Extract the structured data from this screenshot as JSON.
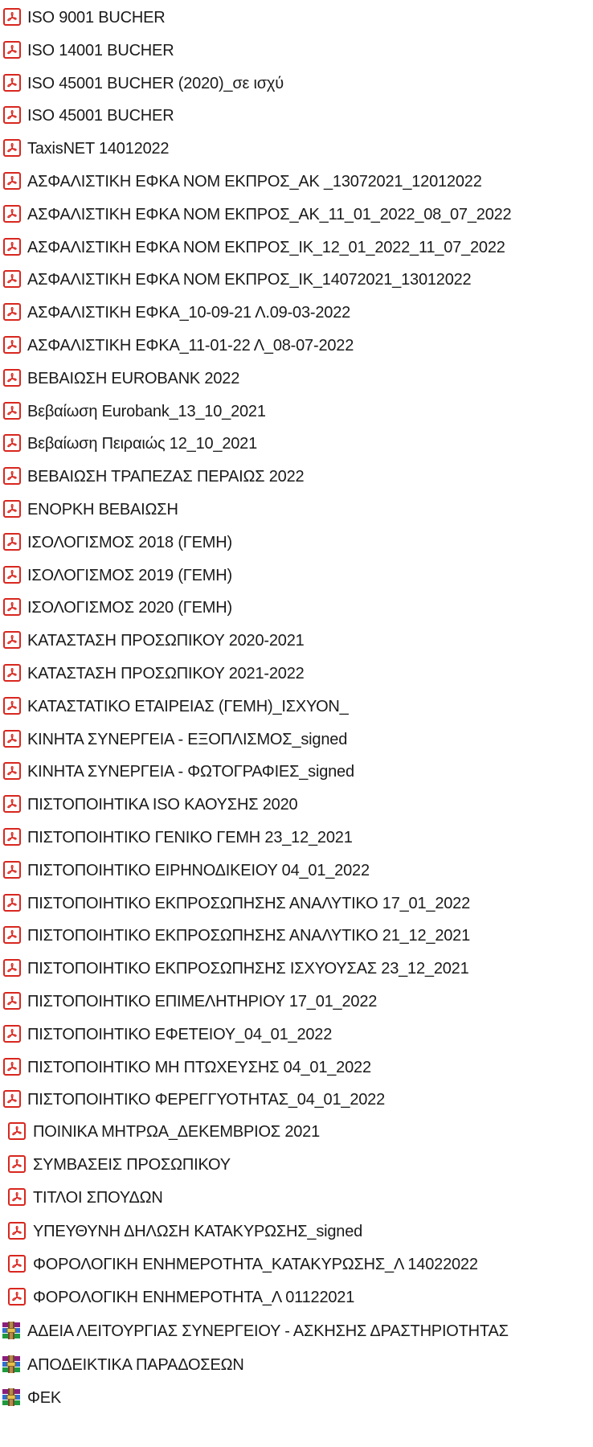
{
  "files": [
    {
      "name": "ISO 9001 BUCHER",
      "type": "pdf",
      "icon": "pdf-file-icon"
    },
    {
      "name": "ISO 14001 BUCHER",
      "type": "pdf",
      "icon": "pdf-file-icon"
    },
    {
      "name": "ISO 45001 BUCHER (2020)_σε ισχύ",
      "type": "pdf",
      "icon": "pdf-file-icon"
    },
    {
      "name": "ISO 45001 BUCHER",
      "type": "pdf",
      "icon": "pdf-file-icon"
    },
    {
      "name": "TaxisNET 14012022",
      "type": "pdf",
      "icon": "pdf-file-icon"
    },
    {
      "name": "ΑΣΦΑΛΙΣΤΙΚΗ ΕΦΚΑ ΝΟΜ ΕΚΠΡΟΣ_ΑΚ _13072021_12012022",
      "type": "pdf",
      "icon": "pdf-file-icon"
    },
    {
      "name": "ΑΣΦΑΛΙΣΤΙΚΗ ΕΦΚΑ ΝΟΜ ΕΚΠΡΟΣ_ΑΚ_11_01_2022_08_07_2022",
      "type": "pdf",
      "icon": "pdf-file-icon"
    },
    {
      "name": "ΑΣΦΑΛΙΣΤΙΚΗ ΕΦΚΑ ΝΟΜ ΕΚΠΡΟΣ_ΙΚ_12_01_2022_11_07_2022",
      "type": "pdf",
      "icon": "pdf-file-icon"
    },
    {
      "name": "ΑΣΦΑΛΙΣΤΙΚΗ ΕΦΚΑ ΝΟΜ ΕΚΠΡΟΣ_ΙΚ_14072021_13012022",
      "type": "pdf",
      "icon": "pdf-file-icon"
    },
    {
      "name": "ΑΣΦΑΛΙΣΤΙΚΗ ΕΦΚΑ_10-09-21 Λ.09-03-2022",
      "type": "pdf",
      "icon": "pdf-file-icon"
    },
    {
      "name": "ΑΣΦΑΛΙΣΤΙΚΗ ΕΦΚΑ_11-01-22 Λ_08-07-2022",
      "type": "pdf",
      "icon": "pdf-file-icon"
    },
    {
      "name": "ΒΕΒΑΙΩΣΗ EUROBANK 2022",
      "type": "pdf",
      "icon": "pdf-file-icon"
    },
    {
      "name": "Βεβαίωση Eurobank_13_10_2021",
      "type": "pdf",
      "icon": "pdf-file-icon"
    },
    {
      "name": "Βεβαίωση Πειραιώς 12_10_2021",
      "type": "pdf",
      "icon": "pdf-file-icon"
    },
    {
      "name": "ΒΕΒΑΙΩΣΗ ΤΡΑΠΕΖΑΣ ΠΕΡΑΙΩΣ 2022",
      "type": "pdf",
      "icon": "pdf-file-icon"
    },
    {
      "name": "ΕΝΟΡΚΗ ΒΕΒΑΙΩΣΗ",
      "type": "pdf",
      "icon": "pdf-file-icon"
    },
    {
      "name": "ΙΣΟΛΟΓΙΣΜΟΣ 2018 (ΓΕΜΗ)",
      "type": "pdf",
      "icon": "pdf-file-icon"
    },
    {
      "name": "ΙΣΟΛΟΓΙΣΜΟΣ 2019 (ΓΕΜΗ)",
      "type": "pdf",
      "icon": "pdf-file-icon"
    },
    {
      "name": "ΙΣΟΛΟΓΙΣΜΟΣ 2020 (ΓΕΜΗ)",
      "type": "pdf",
      "icon": "pdf-file-icon"
    },
    {
      "name": "ΚΑΤΑΣΤΑΣΗ ΠΡΟΣΩΠΙΚΟΥ 2020-2021",
      "type": "pdf",
      "icon": "pdf-file-icon"
    },
    {
      "name": "ΚΑΤΑΣΤΑΣΗ ΠΡΟΣΩΠΙΚΟΥ 2021-2022",
      "type": "pdf",
      "icon": "pdf-file-icon"
    },
    {
      "name": "ΚΑΤΑΣΤΑΤΙΚΟ ΕΤΑΙΡΕΙΑΣ (ΓΕΜΗ)_ΙΣΧΥΟΝ_",
      "type": "pdf",
      "icon": "pdf-file-icon"
    },
    {
      "name": "ΚΙΝΗΤΑ ΣΥΝΕΡΓΕΙΑ - ΕΞΟΠΛΙΣΜΟΣ_signed",
      "type": "pdf",
      "icon": "pdf-file-icon"
    },
    {
      "name": "ΚΙΝΗΤΑ ΣΥΝΕΡΓΕΙΑ - ΦΩΤΟΓΡΑΦΙΕΣ_signed",
      "type": "pdf",
      "icon": "pdf-file-icon"
    },
    {
      "name": "ΠΙΣΤΟΠΟΙΗΤΙΚΑ ISO ΚΑΟΥΣΗΣ 2020",
      "type": "pdf",
      "icon": "pdf-file-icon"
    },
    {
      "name": "ΠΙΣΤΟΠΟΙΗΤΙΚΟ ΓΕΝΙΚΟ ΓΕΜΗ 23_12_2021",
      "type": "pdf",
      "icon": "pdf-file-icon"
    },
    {
      "name": "ΠΙΣΤΟΠΟΙΗΤΙΚΟ ΕΙΡΗΝΟΔΙΚΕΙΟΥ 04_01_2022",
      "type": "pdf",
      "icon": "pdf-file-icon"
    },
    {
      "name": "ΠΙΣΤΟΠΟΙΗΤΙΚΟ ΕΚΠΡΟΣΩΠΗΣΗΣ ΑΝΑΛΥΤΙΚΟ 17_01_2022",
      "type": "pdf",
      "icon": "pdf-file-icon"
    },
    {
      "name": "ΠΙΣΤΟΠΟΙΗΤΙΚΟ ΕΚΠΡΟΣΩΠΗΣΗΣ ΑΝΑΛΥΤΙΚΟ 21_12_2021",
      "type": "pdf",
      "icon": "pdf-file-icon"
    },
    {
      "name": "ΠΙΣΤΟΠΟΙΗΤΙΚΟ ΕΚΠΡΟΣΩΠΗΣΗΣ ΙΣΧΥΟΥΣΑΣ 23_12_2021",
      "type": "pdf",
      "icon": "pdf-file-icon"
    },
    {
      "name": "ΠΙΣΤΟΠΟΙΗΤΙΚΟ ΕΠΙΜΕΛΗΤΗΡΙΟΥ 17_01_2022",
      "type": "pdf",
      "icon": "pdf-file-icon"
    },
    {
      "name": "ΠΙΣΤΟΠΟΙΗΤΙΚΟ ΕΦΕΤΕΙΟΥ_04_01_2022",
      "type": "pdf",
      "icon": "pdf-file-icon"
    },
    {
      "name": "ΠΙΣΤΟΠΟΙΗΤΙΚΟ ΜΗ ΠΤΩΧΕΥΣΗΣ 04_01_2022",
      "type": "pdf",
      "icon": "pdf-file-icon"
    },
    {
      "name": "ΠΙΣΤΟΠΟΙΗΤΙΚΟ ΦΕΡΕΓΓΥΟΤΗΤΑΣ_04_01_2022",
      "type": "pdf",
      "icon": "pdf-file-icon"
    },
    {
      "name": "ΠΟΙΝΙΚΑ ΜΗΤΡΩΑ_ΔΕΚΕΜΒΡΙΟΣ 2021",
      "type": "pdf",
      "icon": "pdf-file-icon"
    },
    {
      "name": "ΣΥΜΒΑΣΕΙΣ ΠΡΟΣΩΠΙΚΟΥ",
      "type": "pdf",
      "icon": "pdf-file-icon"
    },
    {
      "name": "ΤΙΤΛΟΙ ΣΠΟΥΔΩΝ",
      "type": "pdf",
      "icon": "pdf-file-icon"
    },
    {
      "name": "ΥΠΕΥΘΥΝΗ ΔΗΛΩΣΗ ΚΑΤΑΚΥΡΩΣΗΣ_signed",
      "type": "pdf",
      "icon": "pdf-file-icon"
    },
    {
      "name": "ΦΟΡΟΛΟΓΙΚΗ ΕΝΗΜΕΡΟΤΗΤΑ_ΚΑΤΑΚΥΡΩΣΗΣ_Λ 14022022",
      "type": "pdf",
      "icon": "pdf-file-icon"
    },
    {
      "name": "ΦΟΡΟΛΟΓΙΚΗ ΕΝΗΜΕΡΟΤΗΤΑ_Λ 01122021",
      "type": "pdf",
      "icon": "pdf-file-icon"
    },
    {
      "name": "ΑΔΕΙΑ ΛΕΙΤΟΥΡΓΙΑΣ ΣΥΝΕΡΓΕΙΟΥ - ΑΣΚΗΣΗΣ ΔΡΑΣΤΗΡΙΟΤΗΤΑΣ",
      "type": "rar",
      "icon": "rar-archive-icon"
    },
    {
      "name": "ΑΠΟΔΕΙΚΤΙΚΑ ΠΑΡΑΔΟΣΕΩΝ",
      "type": "rar",
      "icon": "rar-archive-icon"
    },
    {
      "name": "ΦΕΚ",
      "type": "rar",
      "icon": "rar-archive-icon"
    }
  ]
}
